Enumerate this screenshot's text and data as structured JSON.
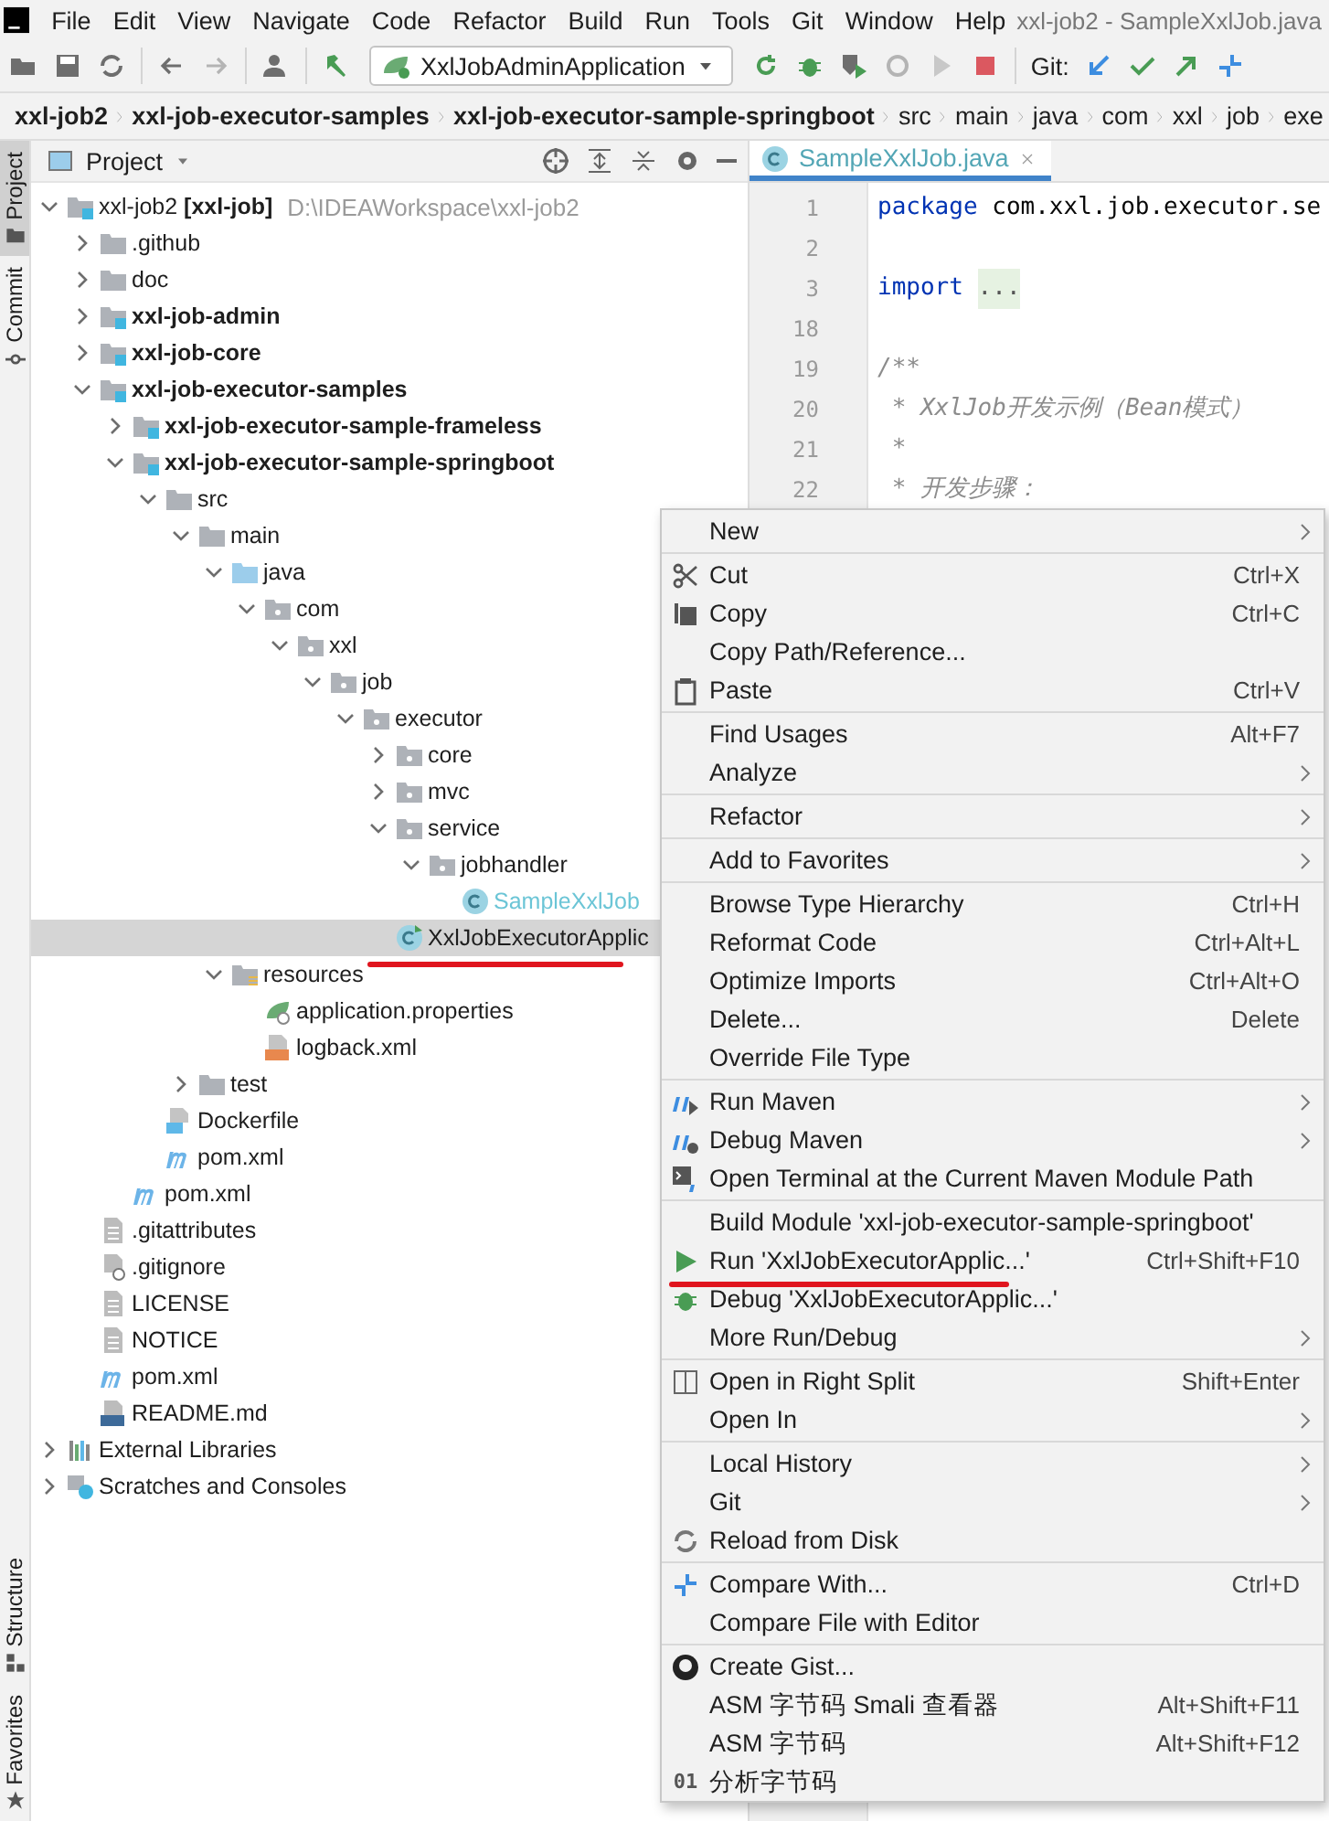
{
  "menu_bar": {
    "items": [
      "File",
      "Edit",
      "View",
      "Navigate",
      "Code",
      "Refactor",
      "Build",
      "Run",
      "Tools",
      "Git",
      "Window",
      "Help"
    ],
    "title": "xxl-job2 - SampleXxlJob.java"
  },
  "toolbar": {
    "run_config": "XxlJobAdminApplication",
    "git_label": "Git:",
    "tools": [
      {
        "kind": "open"
      },
      {
        "kind": "save"
      },
      {
        "kind": "sync"
      },
      {
        "kind": "sep"
      },
      {
        "kind": "back"
      },
      {
        "kind": "forward"
      },
      {
        "kind": "sep"
      },
      {
        "kind": "user"
      },
      {
        "kind": "sep"
      },
      {
        "kind": "build"
      },
      {
        "kind": "config"
      },
      {
        "kind": "rerun"
      },
      {
        "kind": "debug"
      },
      {
        "kind": "coverage"
      },
      {
        "kind": "profile"
      },
      {
        "kind": "run",
        "disabled": true
      },
      {
        "kind": "stop"
      },
      {
        "kind": "sep"
      },
      {
        "kind": "git"
      },
      {
        "kind": "update"
      },
      {
        "kind": "commit"
      },
      {
        "kind": "push"
      },
      {
        "kind": "compare"
      }
    ]
  },
  "breadcrumbs": [
    {
      "label": "xxl-job2",
      "bold": true
    },
    {
      "label": "xxl-job-executor-samples",
      "bold": true
    },
    {
      "label": "xxl-job-executor-sample-springboot",
      "bold": true
    },
    {
      "label": "src",
      "bold": false
    },
    {
      "label": "main",
      "bold": false
    },
    {
      "label": "java",
      "bold": false
    },
    {
      "label": "com",
      "bold": false
    },
    {
      "label": "xxl",
      "bold": false
    },
    {
      "label": "job",
      "bold": false
    },
    {
      "label": "exe",
      "bold": false
    }
  ],
  "side_tabs": [
    {
      "label": "Project",
      "selected": true,
      "kind": "folder"
    },
    {
      "label": "Commit",
      "selected": false,
      "kind": "commit"
    }
  ],
  "side_tabs_bottom": [
    {
      "label": "Structure",
      "selected": false,
      "kind": "structure"
    },
    {
      "label": "Favorites",
      "selected": false,
      "kind": "star"
    }
  ],
  "project_panel": {
    "title": "Project"
  },
  "tree": [
    {
      "label": "xxl-job2 **[xxl-job]**",
      "path": "D:\\IDEAWorkspace\\xxl-job2",
      "kind": "module",
      "expanded": true,
      "children": [
        {
          "label": ".github",
          "kind": "folder",
          "expanded": false
        },
        {
          "label": "doc",
          "kind": "folder",
          "expanded": false
        },
        {
          "label": "xxl-job-admin",
          "kind": "module",
          "bold": true,
          "expanded": false
        },
        {
          "label": "xxl-job-core",
          "kind": "module",
          "bold": true,
          "expanded": false
        },
        {
          "label": "xxl-job-executor-samples",
          "kind": "module",
          "bold": true,
          "expanded": true,
          "children": [
            {
              "label": "xxl-job-executor-sample-frameless",
              "kind": "module",
              "bold": true,
              "expanded": false
            },
            {
              "label": "xxl-job-executor-sample-springboot",
              "kind": "module",
              "bold": true,
              "expanded": true,
              "children": [
                {
                  "label": "src",
                  "kind": "folder",
                  "expanded": true,
                  "children": [
                    {
                      "label": "main",
                      "kind": "folder",
                      "expanded": true,
                      "children": [
                        {
                          "label": "java",
                          "kind": "source",
                          "expanded": true,
                          "children": [
                            {
                              "label": "com",
                              "kind": "package",
                              "expanded": true,
                              "children": [
                                {
                                  "label": "xxl",
                                  "kind": "package",
                                  "expanded": true,
                                  "children": [
                                    {
                                      "label": "job",
                                      "kind": "package",
                                      "expanded": true,
                                      "children": [
                                        {
                                          "label": "executor",
                                          "kind": "package",
                                          "expanded": true,
                                          "children": [
                                            {
                                              "label": "core",
                                              "kind": "package",
                                              "expanded": false
                                            },
                                            {
                                              "label": "mvc",
                                              "kind": "package",
                                              "expanded": false
                                            },
                                            {
                                              "label": "service",
                                              "kind": "package",
                                              "expanded": true,
                                              "children": [
                                                {
                                                  "label": "jobhandler",
                                                  "kind": "package",
                                                  "expanded": true,
                                                  "children": [
                                                    {
                                                      "label": "SampleXxlJob",
                                                      "kind": "class",
                                                      "faded": true,
                                                      "selected": false
                                                    }
                                                  ]
                                                }
                                              ]
                                            },
                                            {
                                              "label": "XxlJobExecutorApplic",
                                              "kind": "spring-class",
                                              "selected": true,
                                              "underlined": true
                                            }
                                          ]
                                        }
                                      ]
                                    }
                                  ]
                                }
                              ]
                            }
                          ]
                        },
                        {
                          "label": "resources",
                          "kind": "resources",
                          "expanded": true,
                          "children": [
                            {
                              "label": "application.properties",
                              "kind": "properties",
                              "selected": false
                            },
                            {
                              "label": "logback.xml",
                              "kind": "xml",
                              "selected": false
                            }
                          ]
                        }
                      ]
                    },
                    {
                      "label": "test",
                      "kind": "folder",
                      "expanded": false
                    }
                  ]
                },
                {
                  "label": "Dockerfile",
                  "kind": "docker",
                  "selected": false
                },
                {
                  "label": "pom.xml",
                  "kind": "maven",
                  "selected": false
                }
              ]
            },
            {
              "label": "pom.xml",
              "kind": "maven",
              "selected": false
            }
          ]
        },
        {
          "label": ".gitattributes",
          "kind": "text",
          "selected": false
        },
        {
          "label": ".gitignore",
          "kind": "ignore",
          "selected": false
        },
        {
          "label": "LICENSE",
          "kind": "text",
          "selected": false
        },
        {
          "label": "NOTICE",
          "kind": "text",
          "selected": false
        },
        {
          "label": "pom.xml",
          "kind": "maven",
          "selected": false
        },
        {
          "label": "README.md",
          "kind": "markdown",
          "selected": false
        }
      ]
    },
    {
      "label": "External Libraries",
      "kind": "libraries",
      "expanded": false
    },
    {
      "label": "Scratches and Consoles",
      "kind": "scratches",
      "expanded": false
    }
  ],
  "editor": {
    "tab": {
      "label": "SampleXxlJob.java",
      "selected": true
    },
    "lines": [
      {
        "number": "1",
        "kind": "package",
        "text": "package",
        "rest": " com.xxl.job.executor.se"
      },
      {
        "number": "2",
        "kind": "blank"
      },
      {
        "number": "3",
        "kind": "import",
        "text": "import",
        "rest": "..."
      },
      {
        "number": "18",
        "kind": "blank"
      },
      {
        "number": "19",
        "kind": "comment",
        "text": "/**"
      },
      {
        "number": "20",
        "kind": "comment",
        "text": " * XxlJob开发示例（Bean模式）"
      },
      {
        "number": "21",
        "kind": "comment",
        "text": " *"
      },
      {
        "number": "22",
        "kind": "comment",
        "text": " * 开发步骤："
      }
    ]
  },
  "context_menu": {
    "groups": [
      [
        {
          "label": "New",
          "submenu": true
        }
      ],
      [
        {
          "label": "Cut",
          "shortcut": "Ctrl+X",
          "kind": "cut"
        },
        {
          "label": "Copy",
          "shortcut": "Ctrl+C",
          "kind": "copy"
        },
        {
          "label": "Copy Path/Reference..."
        },
        {
          "label": "Paste",
          "shortcut": "Ctrl+V",
          "kind": "paste"
        }
      ],
      [
        {
          "label": "Find Usages",
          "shortcut": "Alt+F7"
        },
        {
          "label": "Analyze",
          "submenu": true
        }
      ],
      [
        {
          "label": "Refactor",
          "submenu": true
        }
      ],
      [
        {
          "label": "Add to Favorites",
          "submenu": true
        }
      ],
      [
        {
          "label": "Browse Type Hierarchy",
          "shortcut": "Ctrl+H"
        },
        {
          "label": "Reformat Code",
          "shortcut": "Ctrl+Alt+L"
        },
        {
          "label": "Optimize Imports",
          "shortcut": "Ctrl+Alt+O"
        },
        {
          "label": "Delete...",
          "shortcut": "Delete"
        },
        {
          "label": "Override File Type"
        }
      ],
      [
        {
          "label": "Run Maven",
          "submenu": true,
          "kind": "maven-run"
        },
        {
          "label": "Debug Maven",
          "submenu": true,
          "kind": "maven-debug"
        },
        {
          "label": "Open Terminal at the Current Maven Module Path",
          "kind": "terminal"
        }
      ],
      [
        {
          "label": "Build Module 'xxl-job-executor-sample-springboot'"
        },
        {
          "label": "Run 'XxlJobExecutorApplic...'",
          "shortcut": "Ctrl+Shift+F10",
          "kind": "run",
          "underlined": true
        },
        {
          "label": "Debug 'XxlJobExecutorApplic...'",
          "kind": "debug"
        },
        {
          "label": "More Run/Debug",
          "submenu": true
        }
      ],
      [
        {
          "label": "Open in Right Split",
          "shortcut": "Shift+Enter",
          "kind": "split"
        },
        {
          "label": "Open In",
          "submenu": true
        }
      ],
      [
        {
          "label": "Local History",
          "submenu": true
        },
        {
          "label": "Git",
          "submenu": true
        },
        {
          "label": "Reload from Disk",
          "kind": "reload"
        }
      ],
      [
        {
          "label": "Compare With...",
          "shortcut": "Ctrl+D",
          "kind": "compare"
        },
        {
          "label": "Compare File with Editor"
        }
      ],
      [
        {
          "label": "Create Gist...",
          "kind": "github"
        },
        {
          "label": "ASM 字节码 Smali 查看器",
          "shortcut": "Alt+Shift+F11"
        },
        {
          "label": "ASM 字节码",
          "shortcut": "Alt+Shift+F12"
        },
        {
          "label": "分析字节码",
          "badge": "01"
        }
      ]
    ]
  }
}
